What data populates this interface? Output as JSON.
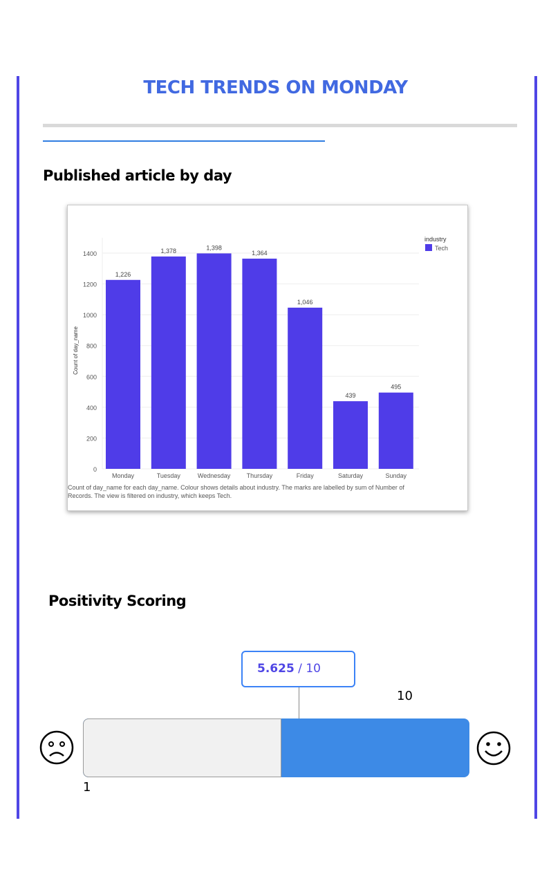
{
  "page": {
    "title": "TECH TRENDS ON MONDAY"
  },
  "sections": {
    "chart_heading": "Published article by day",
    "score_heading": "Positivity Scoring"
  },
  "chart_data": {
    "type": "bar",
    "title": "",
    "xlabel": "",
    "ylabel": "Count of day_name",
    "categories": [
      "Monday",
      "Tuesday",
      "Wednesday",
      "Thursday",
      "Friday",
      "Saturday",
      "Sunday"
    ],
    "series": [
      {
        "name": "Tech",
        "values": [
          1226,
          1378,
          1398,
          1364,
          1046,
          439,
          495
        ],
        "color": "#4f3ce8"
      }
    ],
    "value_labels": [
      "1,226",
      "1,378",
      "1,398",
      "1,364",
      "1,046",
      "439",
      "495"
    ],
    "yticks": [
      0,
      200,
      400,
      600,
      800,
      1000,
      1200,
      1400
    ],
    "ylim": [
      0,
      1500
    ],
    "grid": true,
    "legend": {
      "title": "industry",
      "placement": "top-right"
    },
    "caption": "Count of day_name for each day_name.  Colour shows details about industry.  The marks are labelled by sum of Number of Records. The view is filtered on industry, which keeps Tech."
  },
  "score": {
    "value": 5.625,
    "value_label": "5.625",
    "separator": " / ",
    "max_label": "10",
    "min_label": "1",
    "scale_max_label": "10",
    "min": 1,
    "max": 10
  },
  "colors": {
    "accent": "#4f46e5",
    "title": "#4169e1",
    "bar": "#4f3ce8",
    "score_fill": "#3d8ae6"
  },
  "icons": {
    "left": "sad-face-icon",
    "right": "happy-face-icon"
  }
}
